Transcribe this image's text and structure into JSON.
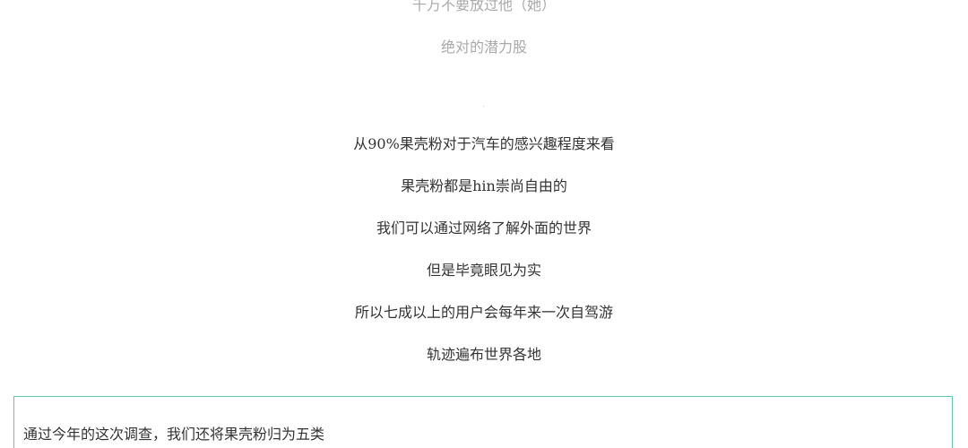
{
  "article": {
    "faded_lines": [
      "千万不要放过他（她）",
      "绝对的潜力股"
    ],
    "lines": [
      "从90%果壳粉对于汽车的感兴趣程度来看",
      "果壳粉都是hin崇尚自由的",
      "我们可以通过网络了解外面的世界",
      "但是毕竟眼见为实",
      "所以七成以上的用户会每年来一次自驾游",
      "轨迹遍布世界各地"
    ],
    "callout": {
      "text": "通过今年的这次调查，我们还将果壳粉归为五类"
    }
  },
  "colors": {
    "text": "#333333",
    "faded_text": "#a9a9a9",
    "callout_border": "#5ec9a8",
    "background": "#ffffff"
  }
}
